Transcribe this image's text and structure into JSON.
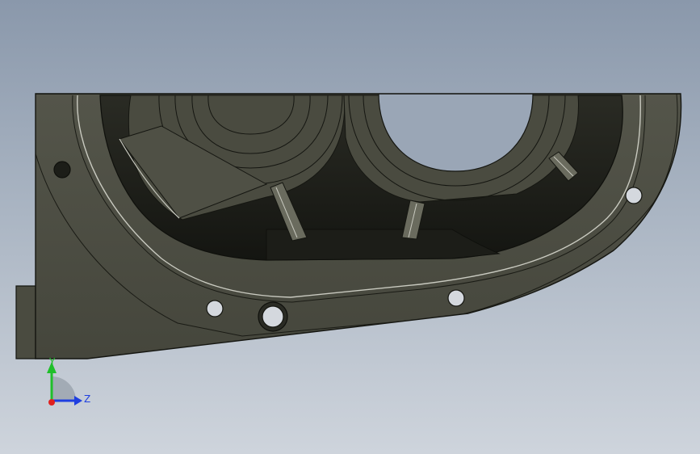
{
  "viewport": {
    "background_top": "#8a98ab",
    "background_bottom": "#ced4dc"
  },
  "model": {
    "body_color": "#4a4b40",
    "inner_color": "#3e3f35",
    "cavity_color": "#1f201b",
    "edge_color": "#151611",
    "highlight_color": "#c9cac0"
  },
  "triad": {
    "y_label": "Y",
    "z_label": "Z",
    "y_color": "#1fbf2a",
    "z_color": "#1f3fe0",
    "x_color": "#e0201f",
    "icon": "coordinate-triad-icon"
  }
}
